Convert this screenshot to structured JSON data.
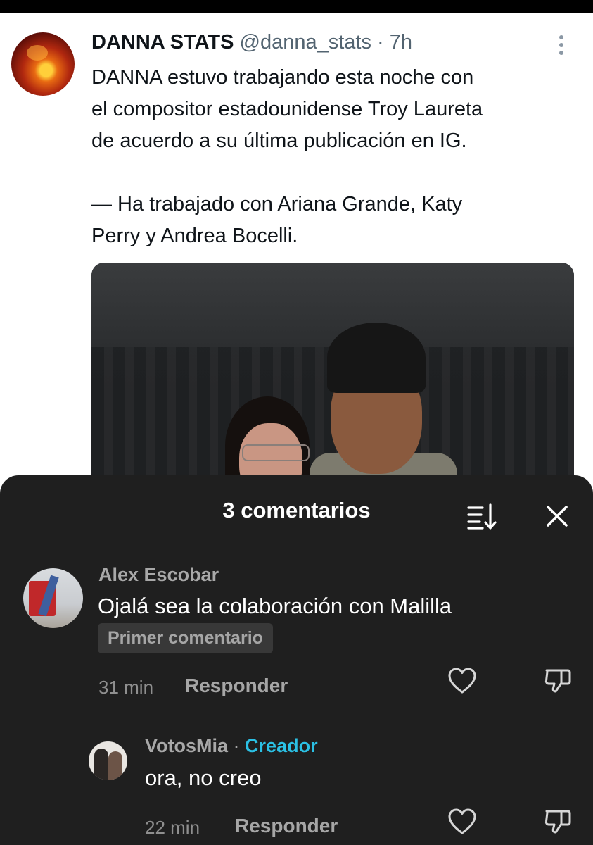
{
  "tweet": {
    "display_name": "DANNA STATS",
    "handle": "@danna_stats",
    "dot": "·",
    "time": "7h",
    "text": "DANNA estuvo trabajando esta noche con\nel compositor estadounidense Troy Laureta\nde acuerdo a su última publicación en IG.\n\n— Ha trabajado con Ariana Grande, Katy\nPerry y Andrea Bocelli.",
    "more_icon": "more-vertical-icon"
  },
  "comments_sheet": {
    "title": "3 comentarios",
    "sort_icon": "sort-icon",
    "close_icon": "close-icon",
    "comments": [
      {
        "author": "Alex Escobar",
        "text": "Ojalá sea la colaboración con Malilla",
        "badge": "Primer comentario",
        "time": "31 min",
        "reply_label": "Responder"
      },
      {
        "author": "VotosMia",
        "separator": "·",
        "creator_label": "Creador",
        "text": "ora, no creo",
        "time": "22 min",
        "reply_label": "Responder"
      }
    ]
  },
  "colors": {
    "sheet_bg": "#1f1f1f",
    "creator_accent": "#2bc0e4",
    "tweet_text": "#0f1419",
    "tweet_meta": "#536471"
  }
}
